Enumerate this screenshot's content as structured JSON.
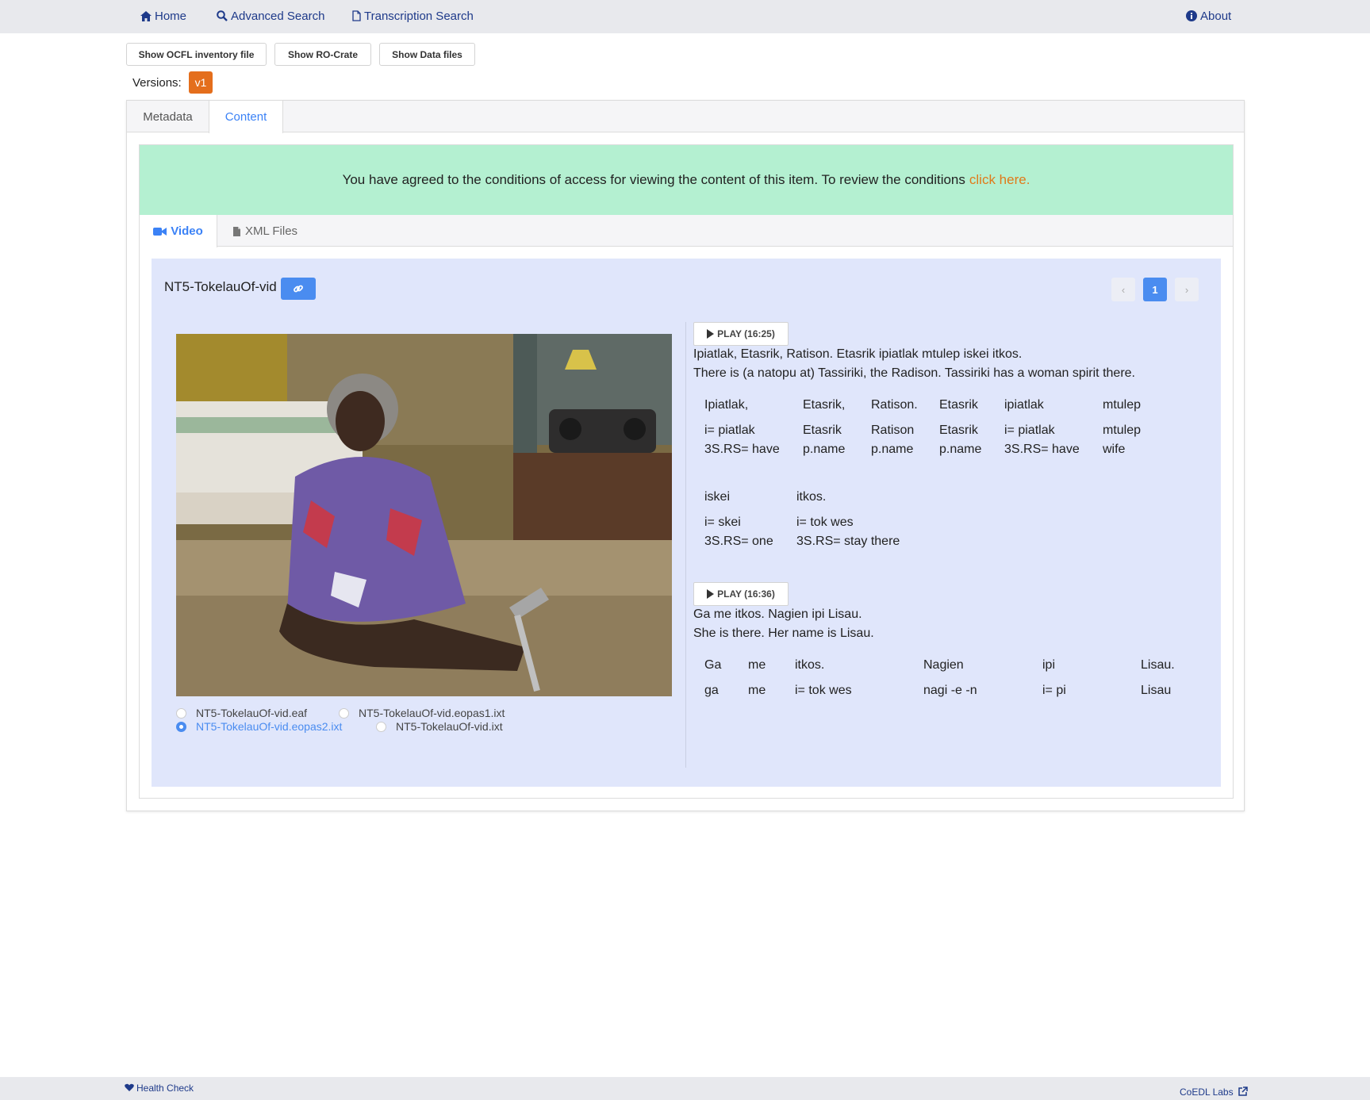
{
  "nav": {
    "home": "Home",
    "advanced_search": "Advanced Search",
    "transcription_search": "Transcription Search",
    "about": "About"
  },
  "actions": {
    "ocfl": "Show OCFL inventory file",
    "rocrate": "Show RO-Crate",
    "datafiles": "Show Data files"
  },
  "versions": {
    "label": "Versions:",
    "current": "v1"
  },
  "tabs": {
    "metadata": "Metadata",
    "content": "Content"
  },
  "notice": {
    "text": "You have agreed to the conditions of access for viewing the content of this item. To review the conditions",
    "link": "click here."
  },
  "subtabs": {
    "video": "Video",
    "xml": "XML Files"
  },
  "item": {
    "title": "NT5-TokelauOf-vid"
  },
  "pager": {
    "prev": "‹",
    "page": "1",
    "next": "›"
  },
  "files": [
    {
      "name": "NT5-TokelauOf-vid.eaf",
      "selected": false
    },
    {
      "name": "NT5-TokelauOf-vid.eopas1.ixt",
      "selected": false
    },
    {
      "name": "NT5-TokelauOf-vid.eopas2.ixt",
      "selected": true
    },
    {
      "name": "NT5-TokelauOf-vid.ixt",
      "selected": false
    }
  ],
  "segments": [
    {
      "play": "PLAY (16:25)",
      "text": "Ipiatlak, Etasrik, Ratison. Etasrik ipiatlak mtulep iskei itkos.",
      "translation": "There is (a natopu at) Tassiriki, the Radison. Tassiriki has a woman spirit there.",
      "words": [
        {
          "word": "Ipiatlak,",
          "morph": "i= piatlak",
          "gloss": "3S.RS= have"
        },
        {
          "word": "Etasrik,",
          "morph": "Etasrik",
          "gloss": "p.name"
        },
        {
          "word": "Ratison.",
          "morph": "Ratison",
          "gloss": "p.name"
        },
        {
          "word": "Etasrik",
          "morph": "Etasrik",
          "gloss": "p.name"
        },
        {
          "word": "ipiatlak",
          "morph": "i= piatlak",
          "gloss": "3S.RS= have"
        },
        {
          "word": "mtulep",
          "morph": "mtulep",
          "gloss": "wife"
        },
        {
          "word": "iskei",
          "morph": "i= skei",
          "gloss": "3S.RS= one"
        },
        {
          "word": "itkos.",
          "morph": "i= tok wes",
          "gloss": "3S.RS= stay there"
        }
      ]
    },
    {
      "play": "PLAY (16:36)",
      "text": "Ga me itkos. Nagien ipi Lisau.",
      "translation": "She is there. Her name is Lisau.",
      "words": [
        {
          "word": "Ga",
          "morph": "ga"
        },
        {
          "word": "me",
          "morph": "me"
        },
        {
          "word": "itkos.",
          "morph": "i= tok wes"
        },
        {
          "word": "Nagien",
          "morph": "nagi -e -n"
        },
        {
          "word": "ipi",
          "morph": "i= pi"
        },
        {
          "word": "Lisau.",
          "morph": "Lisau"
        }
      ]
    }
  ],
  "footer": {
    "health": "Health Check",
    "coedl": "CoEDL Labs"
  },
  "colors": {
    "accent": "#4a8cf0",
    "version": "#e46e1c",
    "notice_bg": "#b4f0d1",
    "panel_bg": "#e0e6fb"
  }
}
